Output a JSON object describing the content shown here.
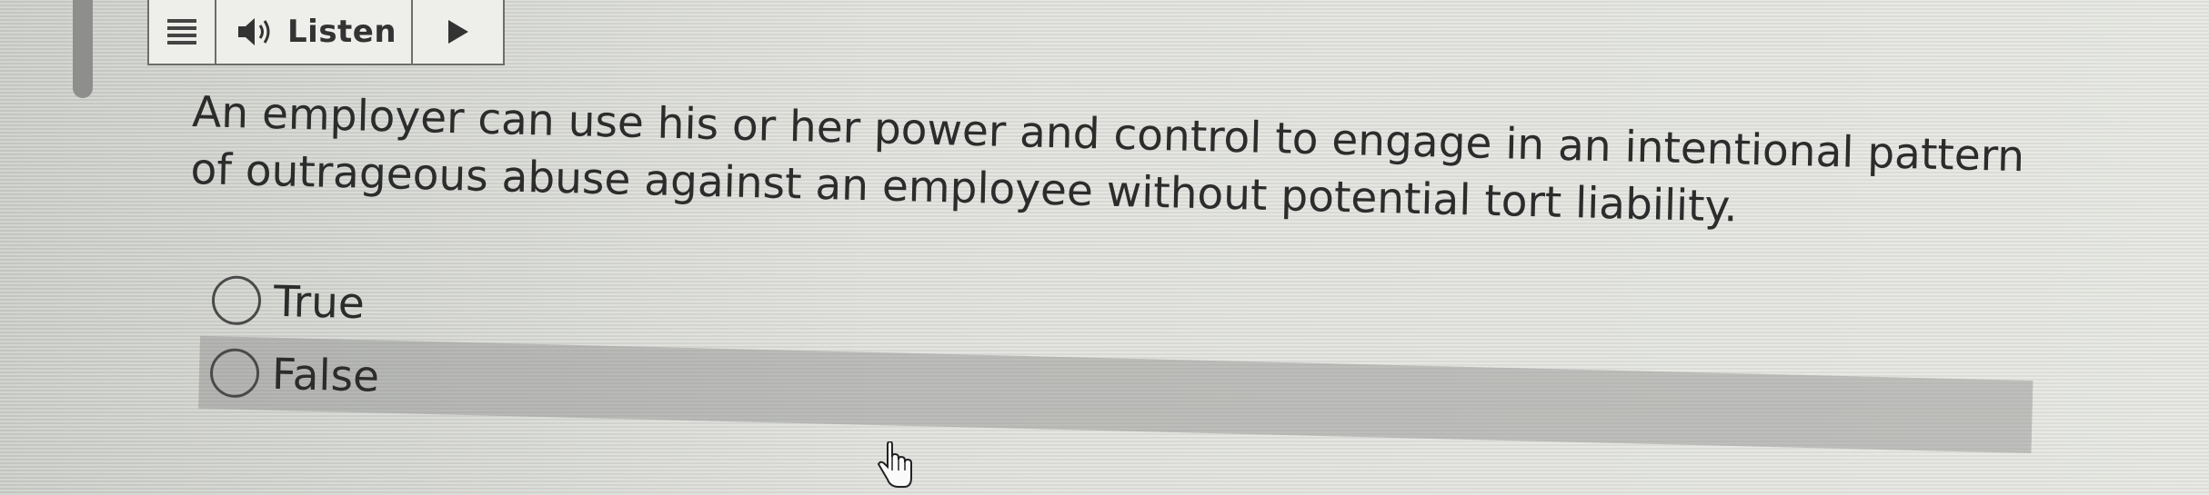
{
  "toolbar": {
    "menu_icon": "menu-lines-icon",
    "listen_icon": "speaker-icon",
    "listen_label": "Listen",
    "play_icon": "play-icon"
  },
  "question": {
    "line1": "An employer can use his or her power and control to engage in an intentional pattern",
    "line2": "of outrageous abuse against an employee without potential tort liability."
  },
  "answers": [
    {
      "label": "True",
      "selected": false,
      "highlighted": false
    },
    {
      "label": "False",
      "selected": false,
      "highlighted": true
    }
  ],
  "cursor": {
    "icon": "hand-pointer-icon"
  }
}
